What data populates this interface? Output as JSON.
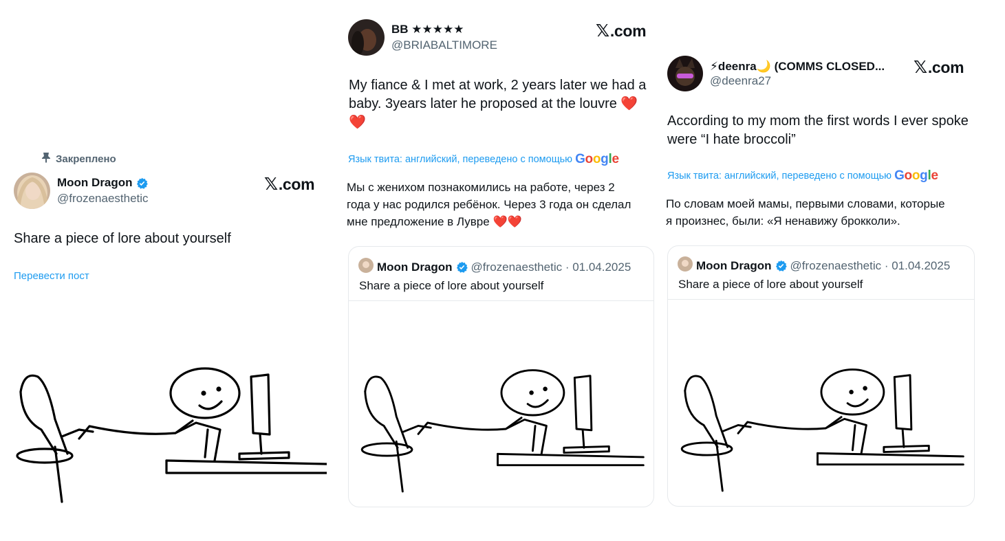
{
  "brand": {
    "logo_x": "𝕏",
    "logo_text": ".com"
  },
  "panel1": {
    "pinned_label": "Закреплено",
    "author_name": "Moon Dragon",
    "author_handle": "@frozenaesthetic",
    "text": "Share a piece of lore about yourself",
    "translate_link": "Перевести пост"
  },
  "panel2": {
    "author_name": "BB ★★★★★",
    "author_handle": "@BRIABALTIMORE",
    "text_line1": "My fiance & I met at work, 2 years later we had a",
    "text_line2": "baby. 3years later he proposed at the louvre ❤️",
    "text_line3": "❤️",
    "lang_note": "Язык твита: английский, переведено с помощью",
    "translation_line1": "Мы с женихом познакомились на работе, через 2",
    "translation_line2": "года у нас родился ребёнок. Через 3 года он сделал",
    "translation_line3": "мне предложение в Лувре ❤️❤️",
    "quote": {
      "name": "Moon Dragon",
      "meta": "@frozenaesthetic · 01.04.2025",
      "text": "Share a piece of lore about yourself"
    }
  },
  "panel3": {
    "author_name": "⚡deenra🌙 (COMMS CLOSED...",
    "author_handle": "@deenra27",
    "text_line1": "According to my mom the first words I ever spoke",
    "text_line2": "were “I hate broccoli”",
    "lang_note": "Язык твита: английский, переведено с помощью",
    "translation_line1": "По словам моей мамы, первыми словами, которые",
    "translation_line2": "я произнес, были: «Я ненавижу брокколи».",
    "quote": {
      "name": "Moon Dragon",
      "meta": "@frozenaesthetic · 01.04.2025",
      "text": "Share a piece of lore about yourself"
    }
  },
  "google_logo": {
    "l1": "G",
    "l2": "o",
    "l3": "o",
    "l4": "g",
    "l5": "l",
    "l6": "e"
  },
  "colors": {
    "link": "#1d9bf0",
    "muted": "#536471",
    "verified": "#1d9bf0",
    "text": "#0f1419"
  },
  "icons": [
    "pin-icon",
    "verified-badge-icon",
    "x-logo-icon",
    "google-logo"
  ]
}
